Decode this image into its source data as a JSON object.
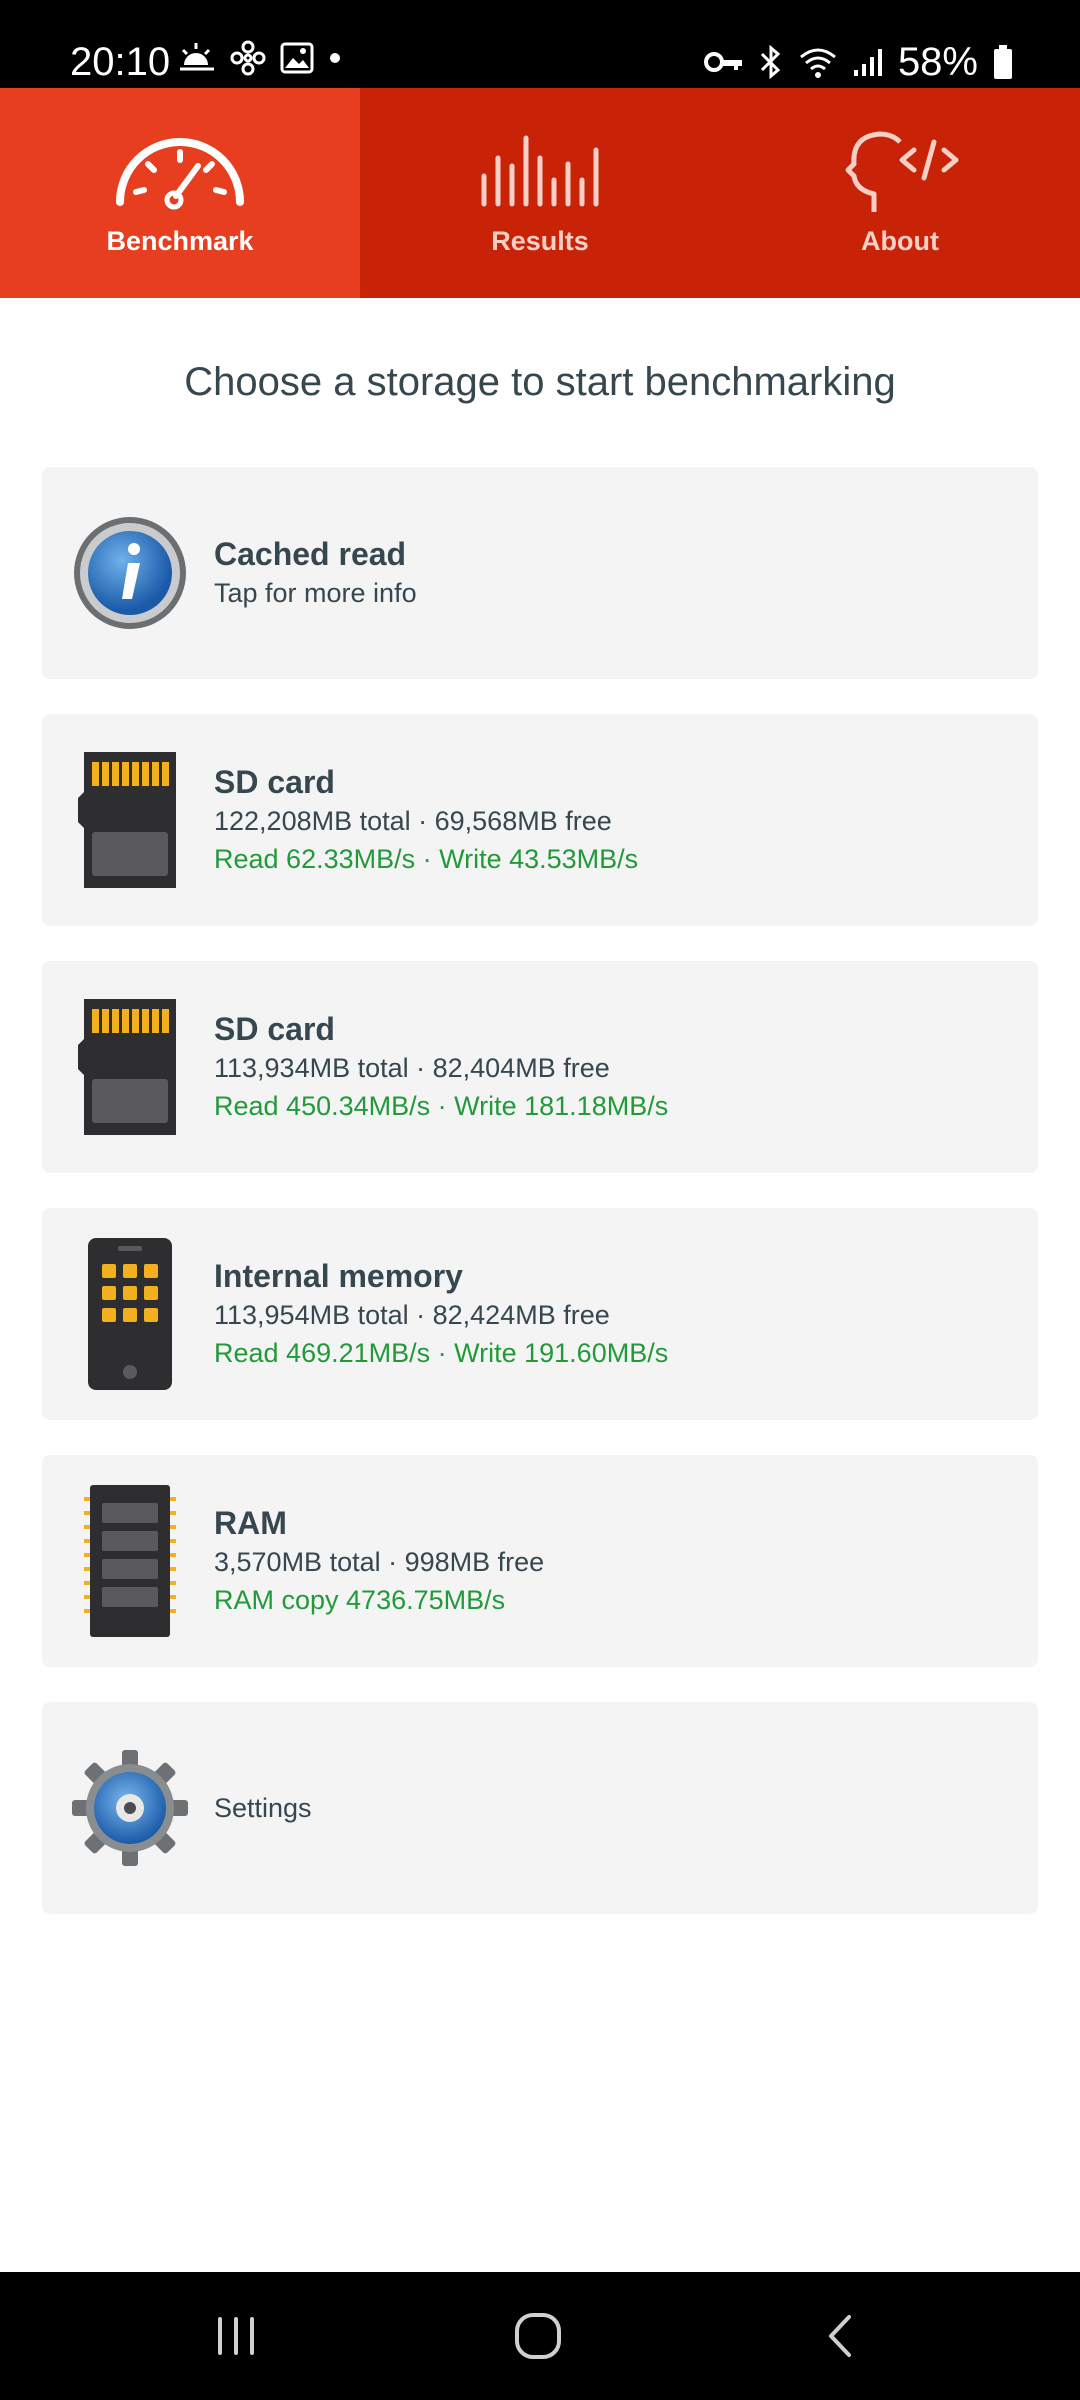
{
  "status_bar": {
    "time": "20:10",
    "battery": "58%",
    "left_icons": [
      "weather-icon",
      "fan-icon",
      "image-icon",
      "dot-icon"
    ],
    "right_icons": [
      "key-icon",
      "bluetooth-icon",
      "wifi-icon",
      "signal-icon",
      "battery-icon"
    ]
  },
  "tabs": [
    {
      "label": "Benchmark",
      "icon": "speedometer-icon",
      "active": true
    },
    {
      "label": "Results",
      "icon": "bars-icon",
      "active": false
    },
    {
      "label": "About",
      "icon": "head-code-icon",
      "active": false
    }
  ],
  "heading": "Choose a storage to start benchmarking",
  "cards": [
    {
      "title": "Cached read",
      "subtitle": "Tap for more info",
      "icon": "info-icon"
    },
    {
      "title": "SD card",
      "details": "122,208MB total · 69,568MB free",
      "speed": "Read 62.33MB/s · Write 43.53MB/s",
      "icon": "sd-card-icon"
    },
    {
      "title": "SD card",
      "details": "113,934MB total · 82,404MB free",
      "speed": "Read 450.34MB/s · Write 181.18MB/s",
      "icon": "sd-card-icon"
    },
    {
      "title": "Internal memory",
      "details": "113,954MB total · 82,424MB free",
      "speed": "Read 469.21MB/s · Write 191.60MB/s",
      "icon": "phone-icon"
    },
    {
      "title": "RAM",
      "details": "3,570MB total · 998MB free",
      "speed": "RAM copy 4736.75MB/s",
      "icon": "ram-icon"
    },
    {
      "label": "Settings",
      "icon": "gear-icon"
    }
  ],
  "colors": {
    "tab_bar": "#c82306",
    "tab_active": "#e63e1e",
    "speed_text": "#229a3a",
    "card_bg": "#f4f4f4"
  },
  "nav_bar": [
    "recents-icon",
    "home-icon",
    "back-icon"
  ]
}
